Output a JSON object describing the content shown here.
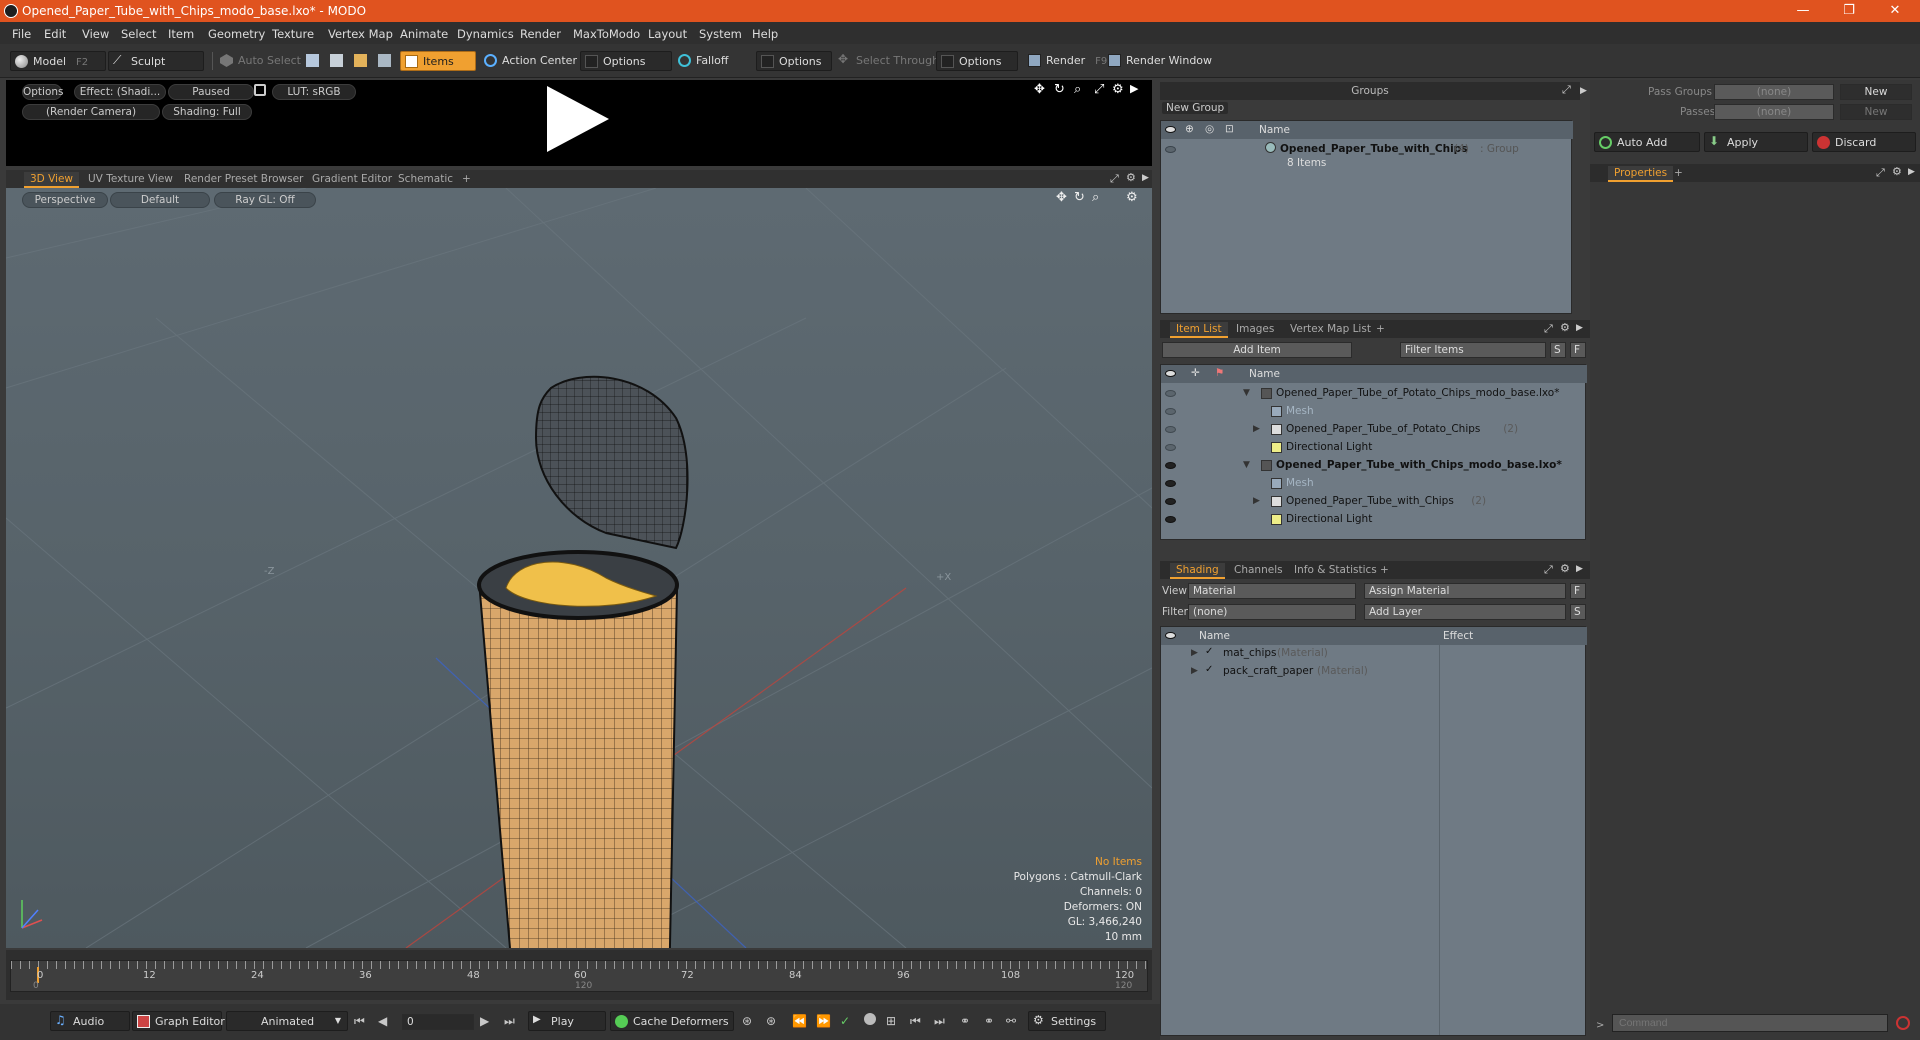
{
  "window": {
    "title": "Opened_Paper_Tube_with_Chips_modo_base.lxo* - MODO",
    "controls": [
      "—",
      "❐",
      "✕"
    ]
  },
  "menu": [
    "File",
    "Edit",
    "View",
    "Select",
    "Item",
    "Geometry",
    "Texture",
    "Vertex Map",
    "Animate",
    "Dynamics",
    "Render",
    "MaxToModo",
    "Layout",
    "System",
    "Help"
  ],
  "toolbar": {
    "model": "Model",
    "model_key": "F2",
    "sculpt": "Sculpt",
    "auto_select": "Auto Select",
    "items": "Items",
    "action_center": "Action Center",
    "options1": "Options",
    "falloff": "Falloff",
    "options2": "Options",
    "select_through": "Select Through",
    "options3": "Options",
    "render": "Render",
    "render_key": "F9",
    "render_window": "Render Window"
  },
  "render_view": {
    "options": "Options",
    "effect": "Effect: (Shadi...",
    "paused": "Paused",
    "lut": "LUT: sRGB",
    "camera": "(Render Camera)",
    "shading": "Shading: Full"
  },
  "viewport_tabs": [
    "3D View",
    "UV Texture View",
    "Render Preset Browser",
    "Gradient Editor",
    "Schematic",
    "+"
  ],
  "viewport": {
    "projection": "Perspective",
    "style": "Default",
    "raygl": "Ray GL: Off",
    "axis_z": "-Z",
    "axis_x": "+X",
    "hud": {
      "selection": "No Items",
      "polygons": "Polygons : Catmull-Clark",
      "channels": "Channels: 0",
      "deformers": "Deformers: ON",
      "gl": "GL: 3,466,240",
      "unit": "10 mm"
    }
  },
  "timeline": {
    "ticks": [
      "0",
      "12",
      "24",
      "36",
      "48",
      "60",
      "72",
      "84",
      "96",
      "108",
      "120"
    ],
    "lower_start": "0",
    "lower_mid": "120",
    "lower_end": "120"
  },
  "bottombar": {
    "audio": "Audio",
    "graph_editor": "Graph Editor",
    "animated": "Animated",
    "frame": "0",
    "play": "Play",
    "cache_deformers": "Cache Deformers",
    "settings": "Settings"
  },
  "groups": {
    "title": "Groups",
    "new_group": "New Group",
    "col_name": "Name",
    "group_name": "Opened_Paper_Tube_with_Chips",
    "group_count": "(4)",
    "group_type": ": Group",
    "group_items": "8 Items"
  },
  "pass": {
    "pass_groups_label": "Pass Groups",
    "pass_groups_value": "(none)",
    "passes_label": "Passes",
    "passes_value": "(none)",
    "new1": "New",
    "new2": "New",
    "auto_add": "Auto Add",
    "apply": "Apply",
    "discard": "Discard",
    "properties_tab": "Properties",
    "plus": "+"
  },
  "itemlist": {
    "tabs": [
      "Item List",
      "Images",
      "Vertex Map List",
      "+"
    ],
    "add_item": "Add Item",
    "filter_items": "Filter Items",
    "s": "S",
    "f": "F",
    "col_name": "Name",
    "rows": [
      {
        "label": "Opened_Paper_Tube_of_Potato_Chips_modo_base.lxo*",
        "count": "",
        "bold": false
      },
      {
        "label": "Mesh",
        "count": "",
        "bold": false
      },
      {
        "label": "Opened_Paper_Tube_of_Potato_Chips",
        "count": "(2)",
        "bold": false
      },
      {
        "label": "Directional Light",
        "count": "",
        "bold": false
      },
      {
        "label": "Opened_Paper_Tube_with_Chips_modo_base.lxo*",
        "count": "",
        "bold": true
      },
      {
        "label": "Mesh",
        "count": "",
        "bold": false
      },
      {
        "label": "Opened_Paper_Tube_with_Chips",
        "count": "(2)",
        "bold": false
      },
      {
        "label": "Directional Light",
        "count": "",
        "bold": false
      }
    ]
  },
  "shading": {
    "tabs": [
      "Shading",
      "Channels",
      "Info & Statistics",
      "+"
    ],
    "view_label": "View",
    "view_value": "Material",
    "assign_material": "Assign Material",
    "f": "F",
    "filter_label": "Filter",
    "filter_value": "(none)",
    "add_layer": "Add Layer",
    "s": "S",
    "col_name": "Name",
    "col_effect": "Effect",
    "rows": [
      {
        "name": "mat_chips",
        "type": "(Material)"
      },
      {
        "name": "pack_craft_paper",
        "type": "(Material)"
      }
    ]
  },
  "command": {
    "placeholder": "Command"
  },
  "colors": {
    "accent": "#f0a030",
    "title": "#e0531f",
    "tube": "#d9a76b"
  }
}
